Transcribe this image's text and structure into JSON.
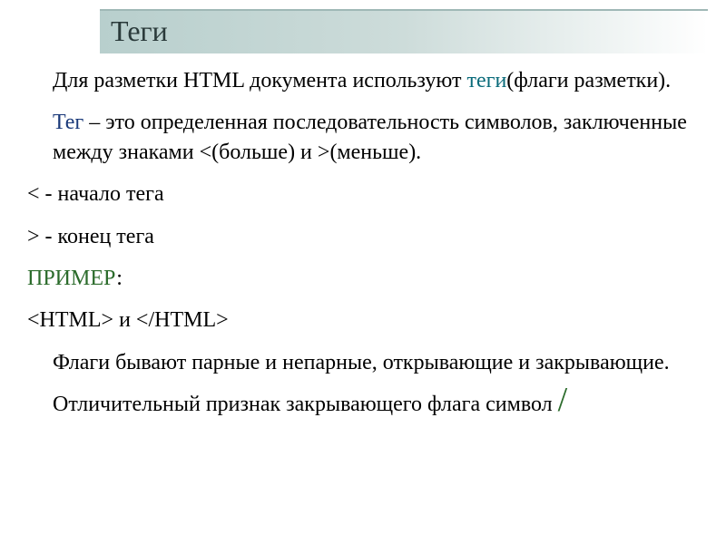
{
  "title": "Теги",
  "para1": {
    "t1": "Для разметки HTML документа используют ",
    "tags": "теги",
    "t2": "(флаги разметки)."
  },
  "para2": {
    "tag_word": "Тег",
    "t1": " – это определенная последовательность символов, заключенные между знаками <(больше)  и  >(меньше)."
  },
  "line_start": "< - начало тега",
  "line_end": "> - конец тега",
  "example_label": "ПРИМЕР",
  "example_colon": ":",
  "example_code": "<HTML> и </HTML>",
  "para3": {
    "t1": "Флаги бывают парные и непарные, открывающие и закрывающие. Отличительный признак закрывающего флага символ ",
    "slash": "/"
  }
}
